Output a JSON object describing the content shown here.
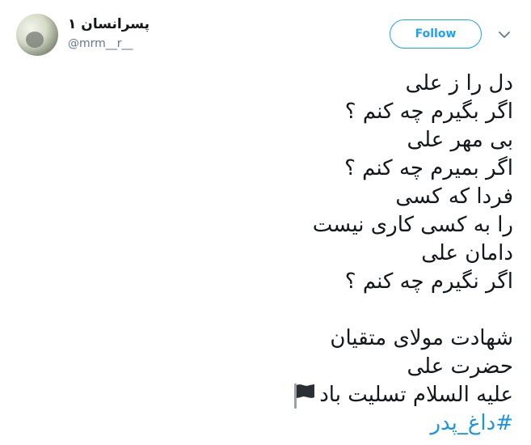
{
  "user": {
    "display_name": "پسرانسان ۱",
    "handle": "@mrm__r__"
  },
  "actions": {
    "follow_label": "Follow",
    "more_icon": "chevron-down-icon"
  },
  "tweet": {
    "lines": [
      "دل را ز علی",
      "اگر بگیرم چه کنم ؟",
      "بی مهر علی",
      "اگر بمیرم چه کنم ؟",
      "فردا که کسی",
      "را به کسی کاری نیست",
      "دامان علی",
      "اگر نگیرم چه کنم ؟",
      "",
      "شهادت مولای متقیان",
      "حضرت علی",
      "علیه السلام تسلیت باد"
    ],
    "flag_icon": "black-flag-icon",
    "hashtag": "#داغ_پدر"
  },
  "colors": {
    "accent": "#1da1f2",
    "hashtag": "#1b95e0",
    "text": "#14171a",
    "muted": "#657786"
  }
}
